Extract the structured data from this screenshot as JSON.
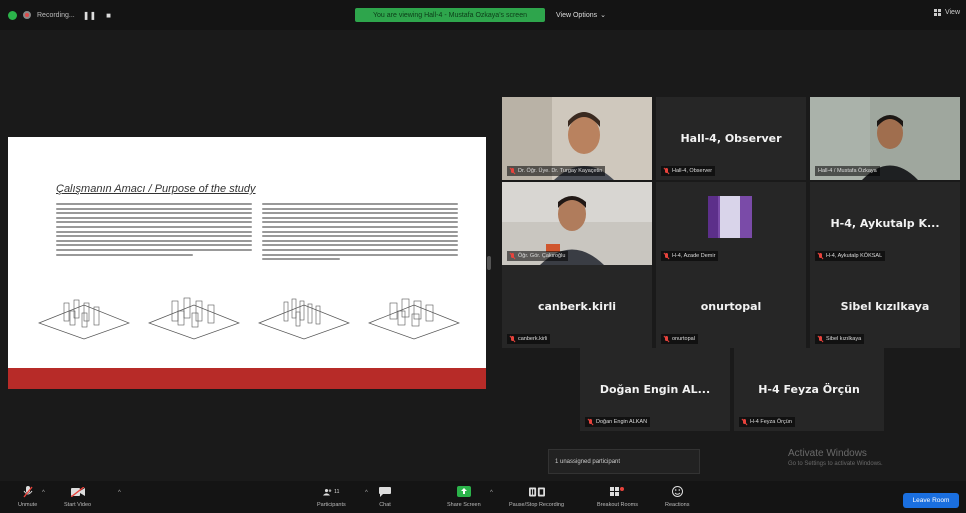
{
  "topbar": {
    "recording_label": "Recording...",
    "pause_glyph": "❚❚",
    "stop_glyph": "■",
    "share_banner": "You are viewing Hall-4 - Mustafa Ozkaya's screen",
    "view_options": "View Options",
    "view_options_caret": "⌄",
    "view_label": "View"
  },
  "slide": {
    "title": "Çalışmanın Amacı / Purpose of the study"
  },
  "tiles": [
    {
      "name": "Dr. Öğr. Üye. Dr. Turgay Kayaçetin",
      "type": "video"
    },
    {
      "name": "Hall-4, Observer",
      "big": "Hall-4, Observer",
      "type": "name"
    },
    {
      "name": "Hall-4 / Mustafa Özkaya",
      "type": "video"
    },
    {
      "name": "Öğr. Gör. Çakıroğlu",
      "type": "video"
    },
    {
      "name": "H-4, Azade Demir",
      "type": "avatar"
    },
    {
      "name": "H-4, Aykutalp KÖKSAL",
      "big": "H-4, Aykutalp K...",
      "type": "name"
    },
    {
      "name": "canberk.kirli",
      "big": "canberk.kirli",
      "type": "name"
    },
    {
      "name": "onurtopal",
      "big": "onurtopal",
      "type": "name"
    },
    {
      "name": "Sibel kızılkaya",
      "big": "Sibel kızılkaya",
      "type": "name"
    },
    {
      "name": "Doğan Engin ALKAN",
      "big": "Doğan Engin AL...",
      "type": "name"
    },
    {
      "name": "H-4 Feyza Örçün",
      "big": "H-4 Feyza Örçün",
      "type": "name"
    }
  ],
  "chat_popup": "1 unassigned participant",
  "watermark": {
    "line1": "Activate Windows",
    "line2": "Go to Settings to activate Windows."
  },
  "toolbar": {
    "unmute": "Unmute",
    "start_video": "Start Video",
    "participants": "Participants",
    "participants_count": "11",
    "chat": "Chat",
    "share_screen": "Share Screen",
    "pause_recording": "Pause/Stop Recording",
    "breakout_rooms": "Breakout Rooms",
    "reactions": "Reactions",
    "leave": "Leave Room"
  },
  "colors": {
    "share_banner": "#2ea54c",
    "slide_footer": "#b72b28",
    "active_speaker": "#a8d23a",
    "leave_button": "#1a6fe0",
    "muted": "#e8433c"
  }
}
